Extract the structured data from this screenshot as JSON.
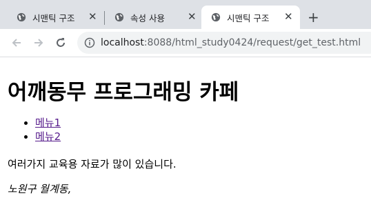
{
  "tabs": [
    {
      "title": "시맨틱 구조",
      "active": false
    },
    {
      "title": "속성 사용",
      "active": false
    },
    {
      "title": "시맨틱 구조",
      "active": true
    }
  ],
  "toolbar": {
    "url_host": "localhost",
    "url_rest": ":8088/html_study0424/request/get_test.html"
  },
  "page": {
    "heading": "어깨동무 프로그래밍 카페",
    "menu": [
      "메뉴1",
      "메뉴2"
    ],
    "description": "여러가지 교육용 자료가 많이 있습니다.",
    "address": "노원구 월계동,"
  },
  "colors": {
    "tabstrip_bg": "#dee1e6",
    "omnibox_bg": "#f1f3f4",
    "visited_link": "#551a8b"
  },
  "icons": {
    "tab": "globe-icon",
    "back": "back-arrow-icon",
    "forward": "forward-arrow-icon",
    "reload": "reload-icon",
    "site_info": "info-icon",
    "new_tab": "plus-icon",
    "close": "close-icon"
  }
}
